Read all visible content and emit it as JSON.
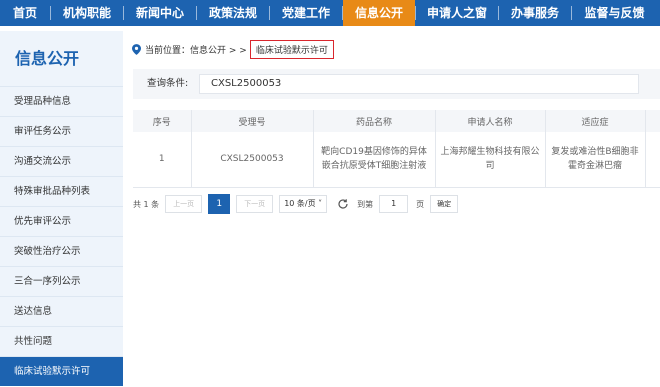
{
  "nav": {
    "items": [
      "首页",
      "机构职能",
      "新闻中心",
      "政策法规",
      "党建工作",
      "信息公开",
      "申请人之窗",
      "办事服务",
      "监督与反馈"
    ],
    "active_index": 5,
    "colors": {
      "bg": "#1d63b0",
      "active": "#e88a17"
    }
  },
  "sidebar": {
    "title": "信息公开",
    "items": [
      "受理品种信息",
      "审评任务公示",
      "沟通交流公示",
      "特殊审批品种列表",
      "优先审评公示",
      "突破性治疗公示",
      "三合一序列公示",
      "送达信息",
      "共性问题",
      "临床试验默示许可"
    ],
    "active_index": 9
  },
  "breadcrumb": {
    "prefix": "当前位置：信息公开 > >",
    "current": "临床试验默示许可"
  },
  "query": {
    "label": "查询条件:",
    "value": "CXSL2500053"
  },
  "table": {
    "headers": [
      "序号",
      "受理号",
      "药品名称",
      "申请人名称",
      "适应症"
    ],
    "rows": [
      [
        "1",
        "CXSL2500053",
        "靶向CD19基因修饰的异体嵌合抗原受体T细胞注射液",
        "上海邦耀生物科技有限公司",
        "复发或难治性B细胞非霍奇金淋巴瘤"
      ]
    ]
  },
  "pager": {
    "total": "共 1 条",
    "prev": "上一页",
    "page": "1",
    "next": "下一页",
    "page_size": "10 条/页",
    "goto_label": "到第",
    "goto_value": "1",
    "page_unit": "页",
    "confirm": "确定"
  }
}
